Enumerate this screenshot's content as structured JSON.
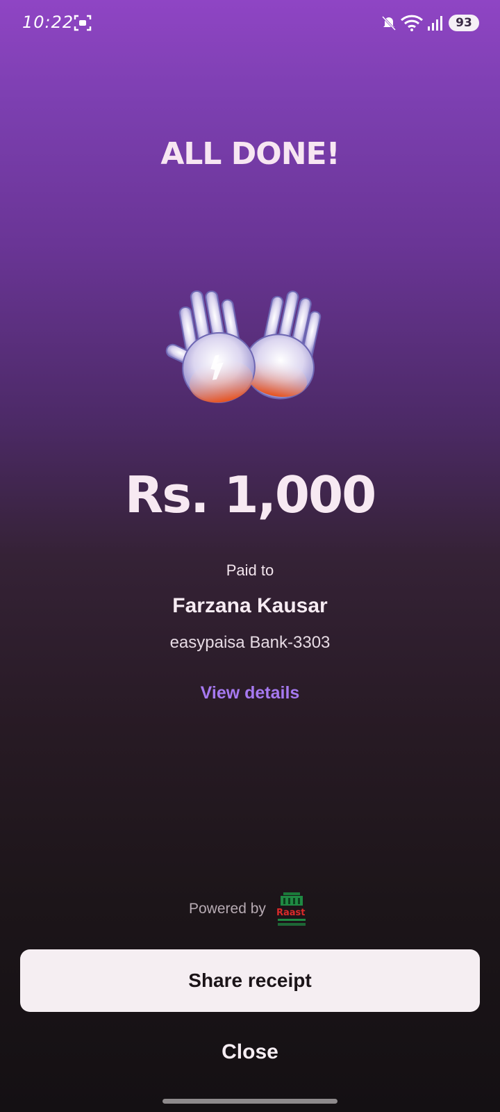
{
  "status_bar": {
    "time": "10:22",
    "battery": "93",
    "icons": [
      "screen-record-icon",
      "mute-icon",
      "wifi-icon",
      "signal-icon",
      "battery-icon"
    ]
  },
  "result": {
    "title": "ALL DONE!",
    "amount": "Rs. 1,000",
    "paid_to_label": "Paid to",
    "payee_name": "Farzana Kausar",
    "account": "easypaisa Bank-3303",
    "view_details_label": "View details"
  },
  "footer": {
    "powered_by": "Powered by",
    "logo_text": "Raast",
    "share_label": "Share receipt",
    "close_label": "Close"
  },
  "colors": {
    "gradient_top": "#8f45c4",
    "gradient_bottom": "#141013",
    "link": "#a679f0",
    "button_bg": "#f5eef2"
  }
}
